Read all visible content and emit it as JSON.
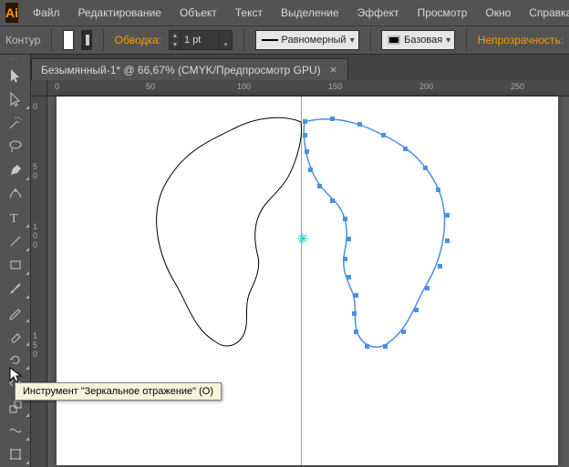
{
  "app_logo": "Ai",
  "menu": [
    "Файл",
    "Редактирование",
    "Объект",
    "Текст",
    "Выделение",
    "Эффект",
    "Просмотр",
    "Окно",
    "Справка"
  ],
  "controlbar": {
    "selection_label": "Контур",
    "stroke_label": "Обводка:",
    "stroke_weight": "1 pt",
    "cap_label": "Равномерный",
    "profile_label": "Базовая",
    "opacity_label": "Непрозрачность:"
  },
  "document_tab": {
    "title": "Безымянный-1* @ 66,67% (CMYK/Предпросмотр GPU)"
  },
  "ruler_h": [
    {
      "pos": 8,
      "label": "0"
    },
    {
      "pos": 58,
      "label": "50"
    },
    {
      "pos": 108,
      "label": "100"
    },
    {
      "pos": 158,
      "label": "150"
    },
    {
      "pos": 208,
      "label": "200"
    },
    {
      "pos": 258,
      "label": "250"
    }
  ],
  "ruler_v": [
    {
      "pos": 6,
      "label": "0"
    },
    {
      "pos": 72,
      "label": "50"
    },
    {
      "pos": 138,
      "label": "100"
    },
    {
      "pos": 204,
      "label": "150"
    }
  ],
  "tooltip": "Инструмент \"Зеркальное отражение\" (O)",
  "tools": [
    "selection",
    "direct-selection",
    "magic-wand",
    "lasso",
    "pen",
    "curvature",
    "type",
    "line",
    "rectangle",
    "paintbrush",
    "pencil",
    "eraser",
    "rotate",
    "reflect",
    "scale",
    "width",
    "free-transform"
  ]
}
